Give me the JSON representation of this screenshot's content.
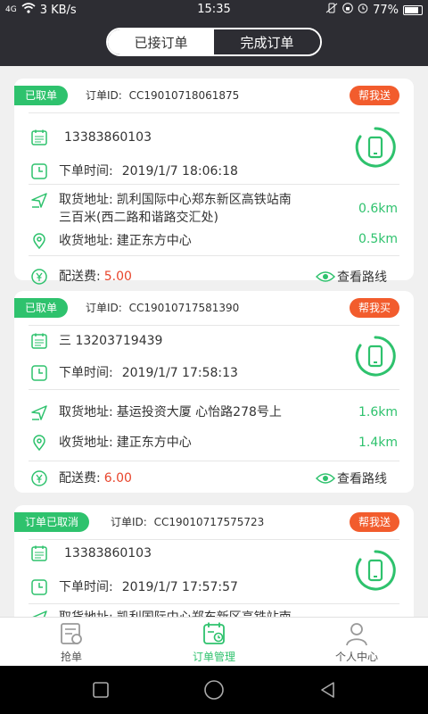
{
  "status_bar": {
    "signal": "4G",
    "speed": "3 KB/s",
    "time": "15:35",
    "battery": "77%"
  },
  "tabs_top": {
    "accepted": "已接订单",
    "completed": "完成订单"
  },
  "labels": {
    "order_id_prefix": "订单ID:",
    "order_time": "下单时间:",
    "pickup": "取货地址:",
    "delivery": "收货地址:",
    "fee": "配送费:",
    "view_route": "查看路线"
  },
  "orders": [
    {
      "status": "已取单",
      "order_id": "CC19010718061875",
      "type": "帮我送",
      "contact": "13383860103",
      "time": "2019/1/7 18:06:18",
      "pickup_line1": "凯利国际中心郑东新区高铁站南",
      "pickup_line2": "三百米(西二路和谐路交汇处)",
      "pickup_distance": "0.6km",
      "delivery": "建正东方中心",
      "delivery_distance": "0.5km",
      "fee": "5.00"
    },
    {
      "status": "已取单",
      "order_id": "CC19010717581390",
      "type": "帮我买",
      "contact": "三  13203719439",
      "time": "2019/1/7 17:58:13",
      "pickup_line1": "基运投资大厦 心怡路278号上",
      "pickup_distance": "1.6km",
      "delivery": "建正东方中心",
      "delivery_distance": "1.4km",
      "fee": "6.00"
    },
    {
      "status": "订单已取消",
      "order_id": "CC19010717575723",
      "type": "帮我送",
      "contact": "13383860103",
      "time": "2019/1/7 17:57:57",
      "pickup_line1": "凯利国际中心郑东新区高铁站南"
    }
  ],
  "tabbar": {
    "grab": "抢单",
    "manage": "订单管理",
    "profile": "个人中心"
  },
  "colors": {
    "green": "#2ec26d",
    "orange": "#f25c2d",
    "dark": "#2d2d33",
    "fee_red": "#e8452c"
  }
}
